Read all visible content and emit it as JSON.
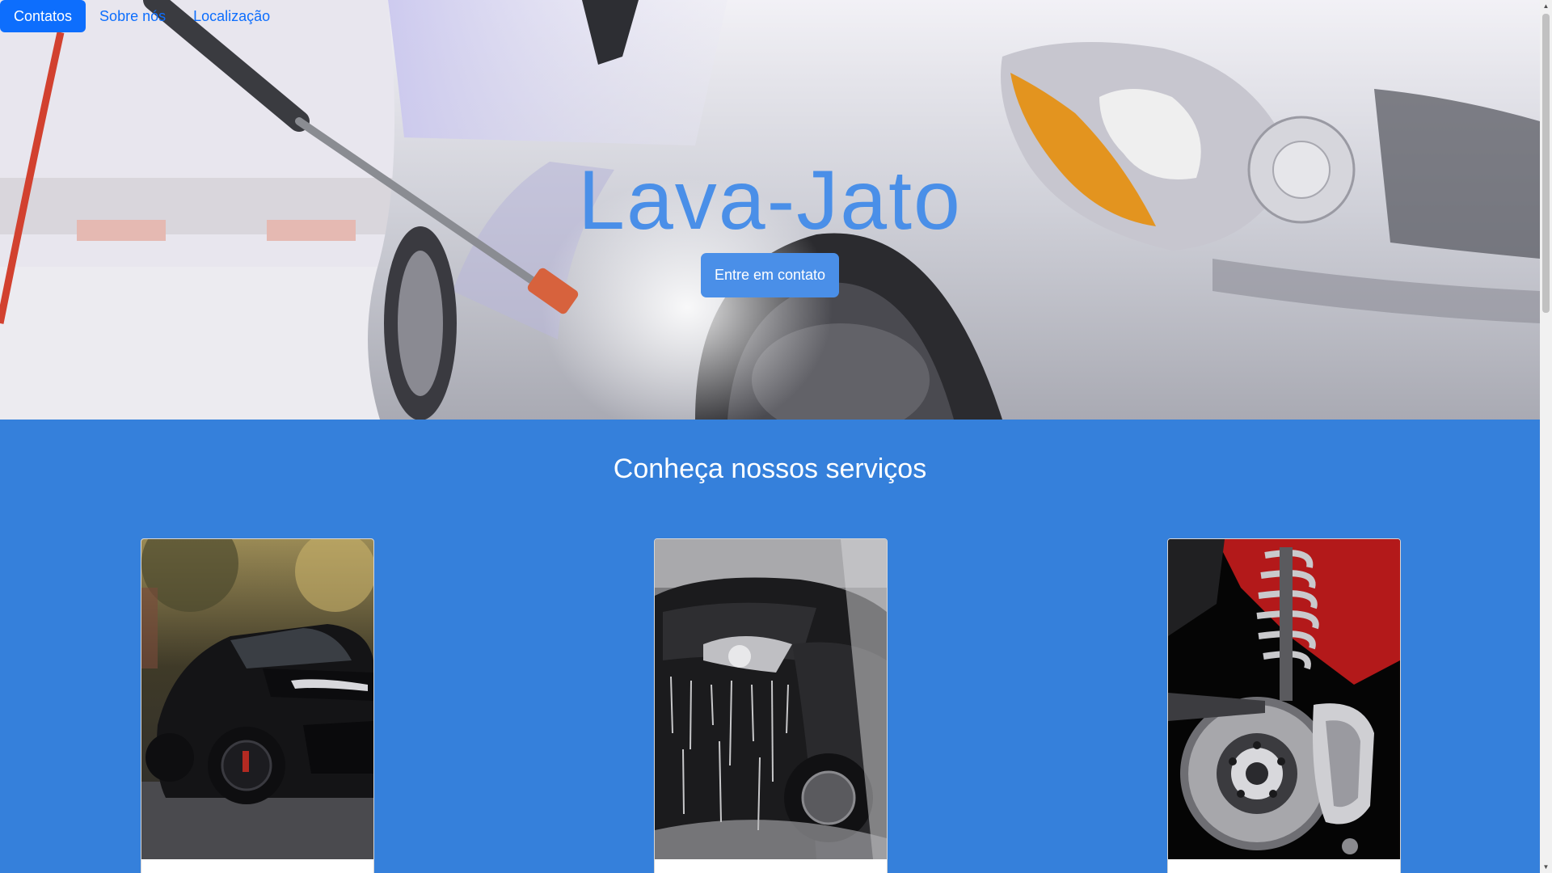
{
  "nav": {
    "items": [
      {
        "label": "Contatos"
      },
      {
        "label": "Sobre nós"
      },
      {
        "label": "Localização"
      }
    ]
  },
  "hero": {
    "title": "Lava-Jato",
    "cta_label": "Entre em contato"
  },
  "services": {
    "title": "Conheça nossos serviços",
    "cards": [
      {
        "image": "black-sports-car-photo"
      },
      {
        "image": "car-washing-foam-photo"
      },
      {
        "image": "brake-suspension-photo"
      }
    ]
  },
  "colors": {
    "primary": "#0d6efd",
    "hero_accent": "#4a8fe8",
    "section_bg": "#3580db"
  }
}
